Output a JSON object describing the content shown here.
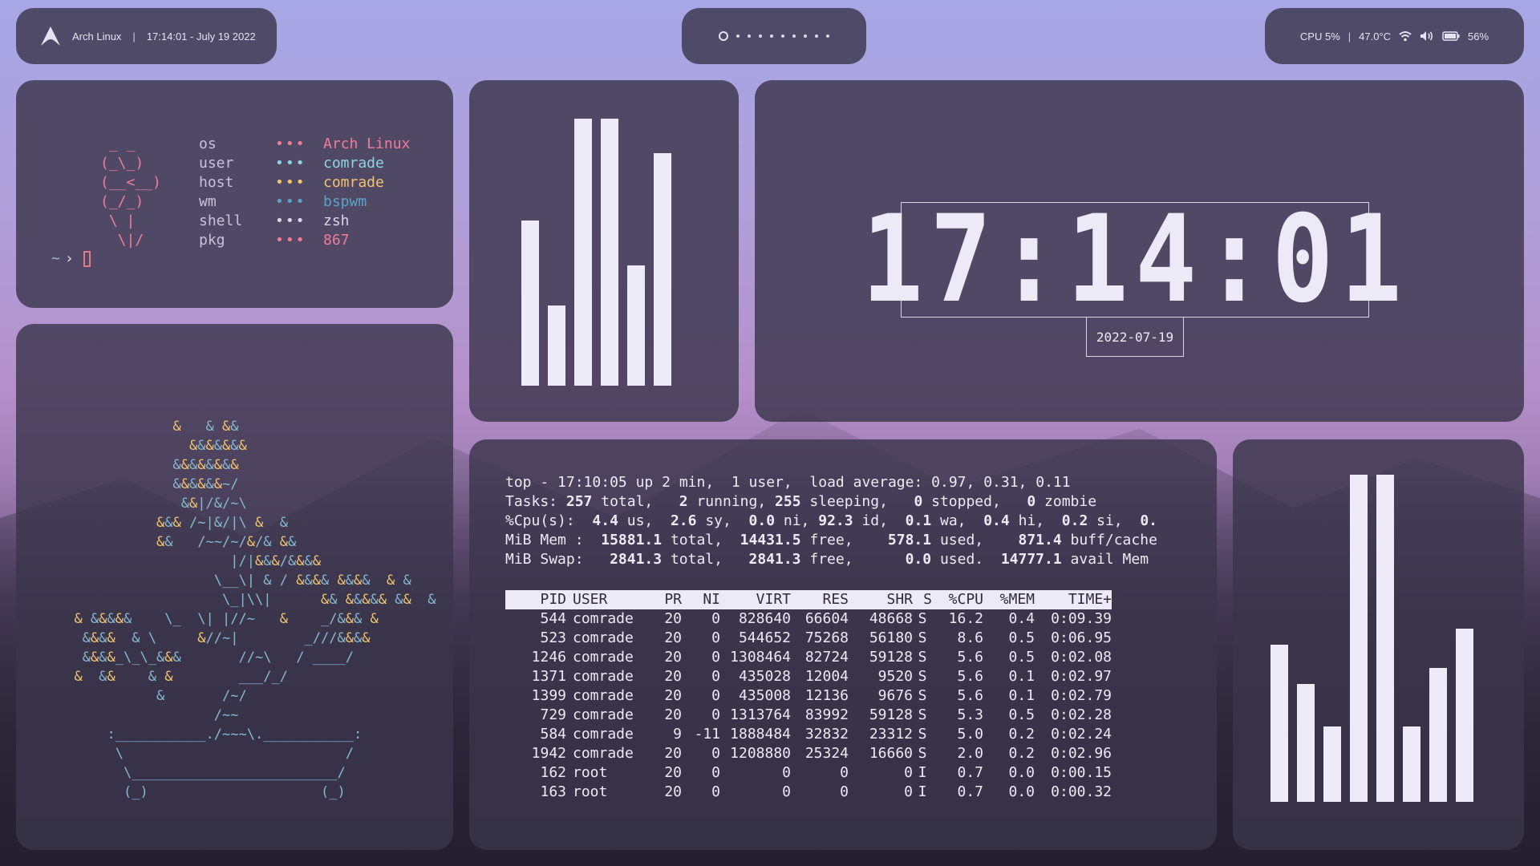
{
  "topbar": {
    "distro": "Arch Linux",
    "separator": "|",
    "datetime": "17:14:01 - July 19 2022",
    "workspaces_count": 10,
    "cpu": "CPU  5%",
    "temp": "47.0°C",
    "battery": "56%"
  },
  "fetch": {
    "art": " _ _\n(_\\_)\n(__<__)\n(_/_)\n \\ |\n  \\|/",
    "rows": [
      {
        "key": "os",
        "dots": "•••",
        "value": "Arch Linux",
        "color": "#f07c98"
      },
      {
        "key": "user",
        "dots": "•••",
        "value": "comrade",
        "color": "#8fd3e0"
      },
      {
        "key": "host",
        "dots": "•••",
        "value": "comrade",
        "color": "#f2c46d"
      },
      {
        "key": "wm",
        "dots": "•••",
        "value": "bspwm",
        "color": "#5aa3c8"
      },
      {
        "key": "shell",
        "dots": "•••",
        "value": "zsh",
        "color": "#d9d6ea"
      },
      {
        "key": "pkg",
        "dots": "•••",
        "value": "867",
        "color": "#f07c98"
      }
    ],
    "prompt_tilde": "~",
    "prompt_arrow": "›"
  },
  "tree_art": "              &   & &&\n                &&&&&&&\n              &&&&&&&&\n              &&&&&&~/\n               &&|/&/~\\\n            &&& /~|&/|\\ &  &\n            &&   /~~/~/&/& &&\n                     |/|&&&/&&&&\n                   \\__\\| & / &&&& &&&&  & &\n                    \\_|\\\\|      && &&&&& &&  &\n  & &&&&&    \\_  \\| |//~   &    _/&&& &\n   &&&&  & \\     &//~|        _///&&&&\n   &&&&_\\_\\_&&&       //~\\   / ____/\n  &  &&    & &        ___/_/\n            &       /~/\n                   /~~\n      :___________./~~~\\.___________:\n       \\                           /\n        \\_________________________/\n        (_)                     (_)",
  "bars_a": [
    62,
    30,
    100,
    100,
    45,
    87
  ],
  "bars_b": [
    48,
    36,
    23,
    100,
    100,
    23,
    41,
    53
  ],
  "clock": {
    "time": "17:14:01",
    "date": "2022-07-19"
  },
  "top": {
    "summary": [
      "top - 17:10:05 up 2 min,  1 user,  load average: 0.97, 0.31, 0.11",
      "Tasks: 257 total,   2 running, 255 sleeping,   0 stopped,   0 zombie",
      "%Cpu(s):  4.4 us,  2.6 sy,  0.0 ni, 92.3 id,  0.1 wa,  0.4 hi,  0.2 si,  0.",
      "MiB Mem :  15881.1 total,  14431.5 free,    578.1 used,    871.4 buff/cache",
      "MiB Swap:   2841.3 total,   2841.3 free,      0.0 used.  14777.1 avail Mem"
    ],
    "columns": [
      "PID",
      "USER",
      "PR",
      "NI",
      "VIRT",
      "RES",
      "SHR",
      "S",
      "%CPU",
      "%MEM",
      "TIME+"
    ],
    "rows": [
      [
        "544",
        "comrade",
        "20",
        "0",
        "828640",
        "66604",
        "48668",
        "S",
        "16.2",
        "0.4",
        "0:09.39"
      ],
      [
        "523",
        "comrade",
        "20",
        "0",
        "544652",
        "75268",
        "56180",
        "S",
        "8.6",
        "0.5",
        "0:06.95"
      ],
      [
        "1246",
        "comrade",
        "20",
        "0",
        "1308464",
        "82724",
        "59128",
        "S",
        "5.6",
        "0.5",
        "0:02.08"
      ],
      [
        "1371",
        "comrade",
        "20",
        "0",
        "435028",
        "12004",
        "9520",
        "S",
        "5.6",
        "0.1",
        "0:02.97"
      ],
      [
        "1399",
        "comrade",
        "20",
        "0",
        "435008",
        "12136",
        "9676",
        "S",
        "5.6",
        "0.1",
        "0:02.79"
      ],
      [
        "729",
        "comrade",
        "20",
        "0",
        "1313764",
        "83992",
        "59128",
        "S",
        "5.3",
        "0.5",
        "0:02.28"
      ],
      [
        "584",
        "comrade",
        "9",
        "-11",
        "1888484",
        "32832",
        "23312",
        "S",
        "5.0",
        "0.2",
        "0:02.24"
      ],
      [
        "1942",
        "comrade",
        "20",
        "0",
        "1208880",
        "25324",
        "16660",
        "S",
        "2.0",
        "0.2",
        "0:02.96"
      ],
      [
        "162",
        "root",
        "20",
        "0",
        "0",
        "0",
        "0",
        "I",
        "0.7",
        "0.0",
        "0:00.15"
      ],
      [
        "163",
        "root",
        "20",
        "0",
        "0",
        "0",
        "0",
        "I",
        "0.7",
        "0.0",
        "0:00.32"
      ]
    ]
  }
}
